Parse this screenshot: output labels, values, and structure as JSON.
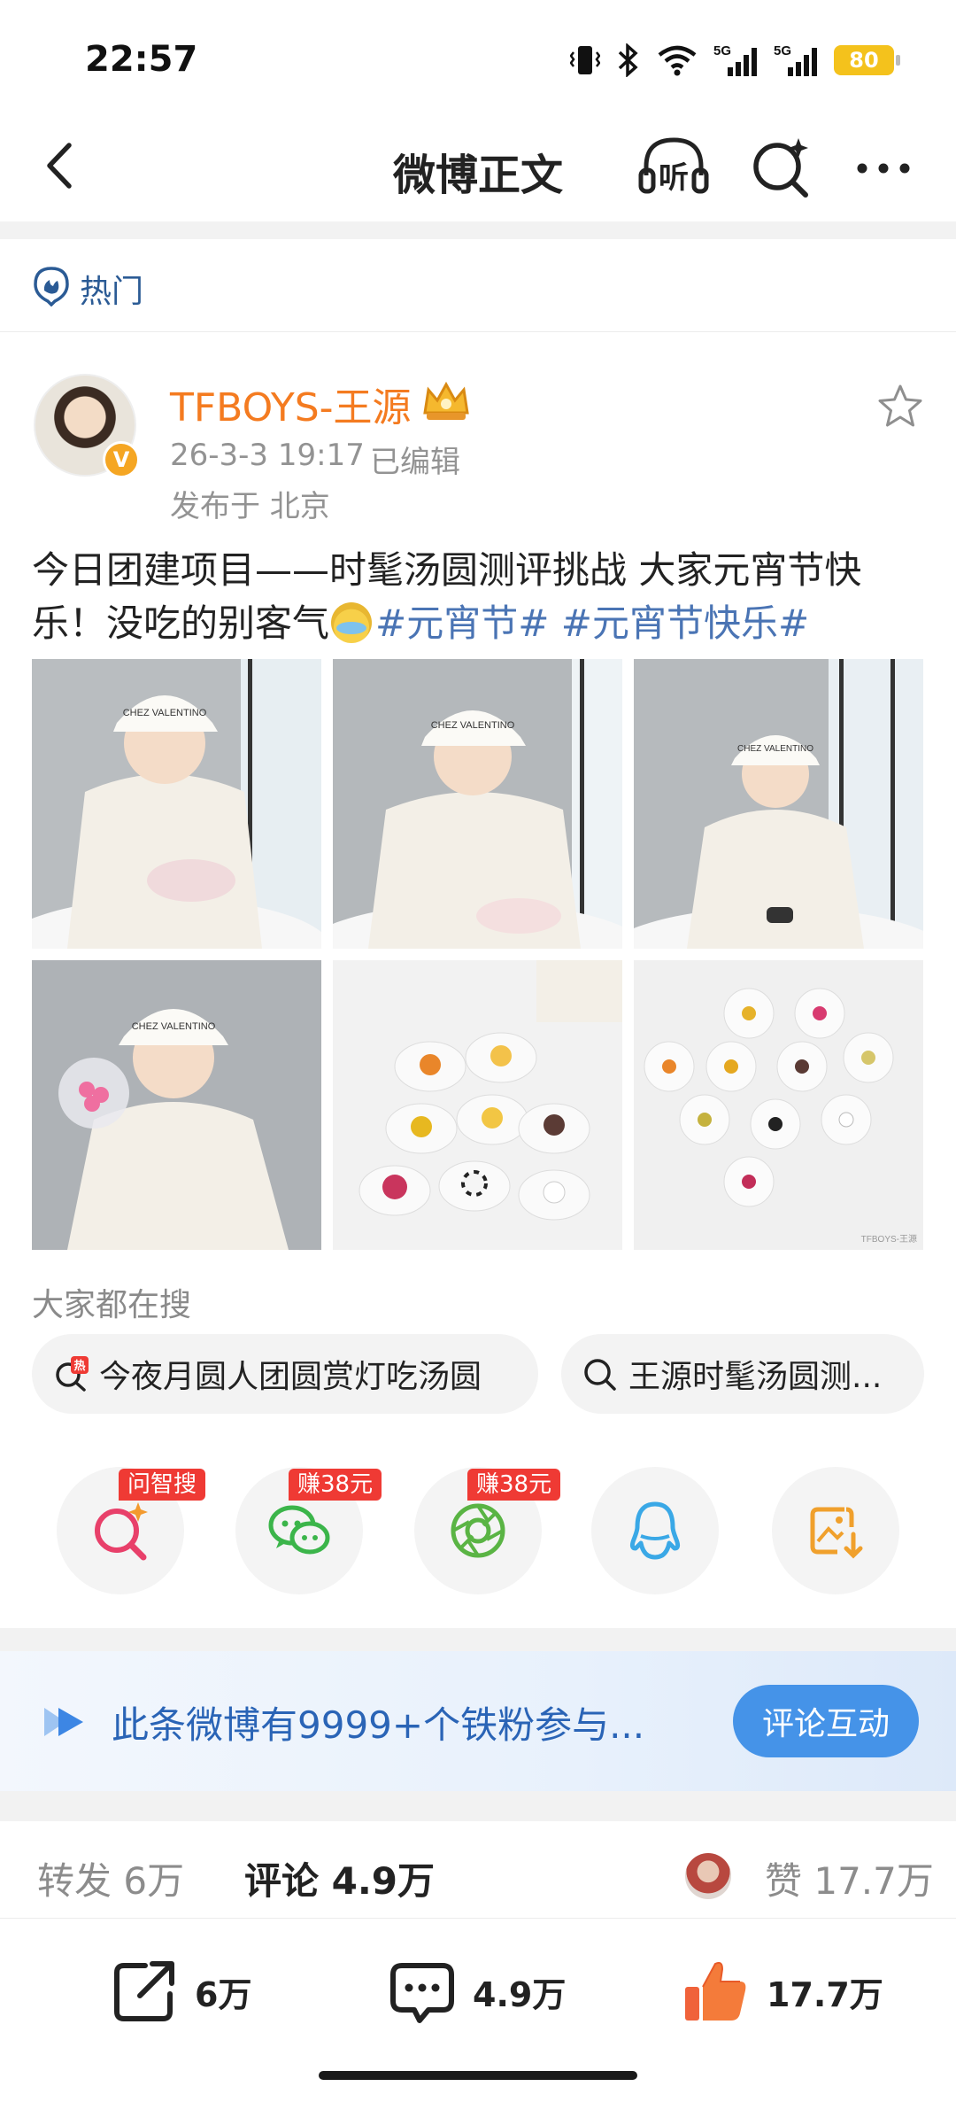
{
  "status_bar": {
    "time": "22:57",
    "battery": "80",
    "network_label": "5G",
    "icons": [
      "vibrate-icon",
      "bluetooth-icon",
      "wifi-icon",
      "signal-5g-icon",
      "signal-5g-icon",
      "battery-icon"
    ]
  },
  "nav": {
    "title": "微博正文",
    "listen_label": "听",
    "icons": [
      "back-icon",
      "listen-icon",
      "ai-search-icon",
      "more-icon"
    ]
  },
  "hot": {
    "label": "热门"
  },
  "author": {
    "name": "TFBOYS-王源",
    "verified_mark": "V",
    "time": "26-3-3 19:17",
    "edited": "已编辑",
    "location": "发布于 北京"
  },
  "post": {
    "text_main": "今日团建项目——时髦汤圆测评挑战 大家元宵节快乐！没吃的别客气",
    "hashtags": [
      "#元宵节#",
      "#元宵节快乐#"
    ],
    "photos": [
      "photo-eating-1",
      "photo-eating-2",
      "photo-eating-3",
      "photo-holding-tangyuan",
      "photo-tangyuan-table",
      "photo-tangyuan-cups"
    ],
    "photo_cap_text": "CHEZ VALENTINO",
    "watermark": "TFBOYS-王源"
  },
  "search": {
    "title": "大家都在搜",
    "hot_badge": "热",
    "items": [
      "今夜月圆人团圆赏灯吃汤圆",
      "王源时髦汤圆测..."
    ]
  },
  "share": {
    "items": [
      {
        "name": "ai-search-share",
        "tag": "问智搜"
      },
      {
        "name": "wechat-share",
        "tag": "赚38元"
      },
      {
        "name": "moments-share",
        "tag": "赚38元"
      },
      {
        "name": "qq-share",
        "tag": ""
      },
      {
        "name": "save-image-share",
        "tag": ""
      }
    ]
  },
  "fans_banner": {
    "text": "此条微博有9999+个铁粉参与...",
    "button": "评论互动"
  },
  "stats": {
    "repost": "转发 6万",
    "comment": "评论 4.9万",
    "like": "赞 17.7万"
  },
  "actions": {
    "repost_count": "6万",
    "comment_count": "4.9万",
    "like_count": "17.7万"
  },
  "colors": {
    "author": "#f47b20",
    "link": "#4a74b4",
    "banner_text": "#2a64b6",
    "banner_button": "#4593e8",
    "tag_red": "#ef3a34"
  }
}
